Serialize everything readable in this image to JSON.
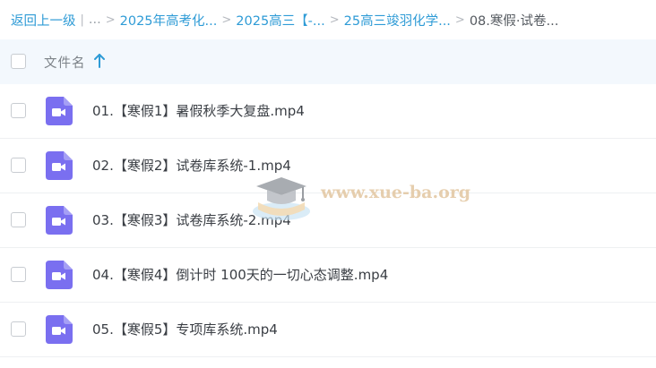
{
  "breadcrumb": {
    "back_label": "返回上一级",
    "ellipsis": "...",
    "items": [
      "2025年高考化...",
      "2025高三【-...",
      "25高三竣羽化学..."
    ],
    "current": "08.寒假·试卷..."
  },
  "table": {
    "header_label": "文件名",
    "sort_icon": "arrow-up-icon",
    "files": [
      {
        "name": "01.【寒假1】暑假秋季大复盘.mp4",
        "icon": "video-file-icon"
      },
      {
        "name": "02.【寒假2】试卷库系统-1.mp4",
        "icon": "video-file-icon"
      },
      {
        "name": "03.【寒假3】试卷库系统-2.mp4",
        "icon": "video-file-icon"
      },
      {
        "name": "04.【寒假4】倒计时 100天的一切心态调整.mp4",
        "icon": "video-file-icon"
      },
      {
        "name": "05.【寒假5】专项库系统.mp4",
        "icon": "video-file-icon"
      }
    ]
  },
  "watermark": {
    "text": "www.xue-ba.org"
  },
  "colors": {
    "link": "#2e9bd6",
    "header_bg": "#f3f8fd",
    "video_icon": "#7a6ff0",
    "row_border": "#eef0f2"
  }
}
